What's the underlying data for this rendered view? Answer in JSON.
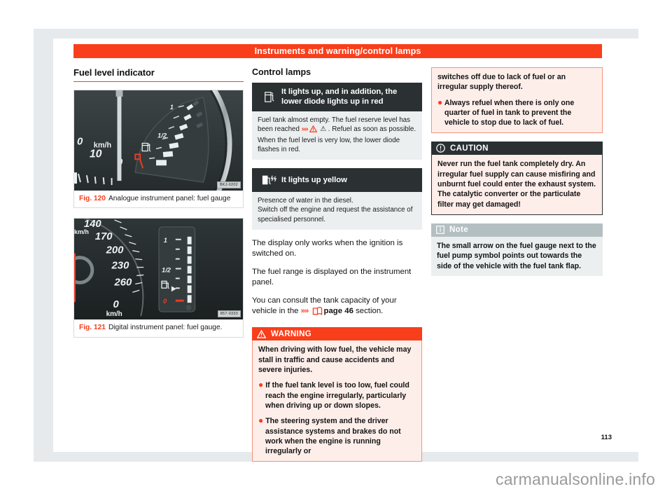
{
  "chapter": {
    "title": "Instruments and warning/control lamps"
  },
  "left_column": {
    "heading": "Fuel level indicator",
    "figures": [
      {
        "number": "Fig. 120",
        "caption": "Analogue instrument panel: fuel gauge",
        "stamp": "BKJ-0202",
        "alt": "analogue-instrument-panel-fuel-gauge",
        "labels": {
          "unit": "km/h",
          "full": "1",
          "half": "1/2",
          "speed_a": "0",
          "speed_b": "10",
          "speed_c": "0"
        }
      },
      {
        "number": "Fig. 121",
        "caption": "Digital instrument panel: fuel gauge.",
        "stamp": "857-0333",
        "alt": "digital-instrument-panel-fuel-gauge",
        "labels": {
          "unit": "km/h",
          "full": "1",
          "half": "1/2",
          "empty": "0",
          "zero": "0",
          "s1": "140",
          "s2": "170",
          "s3": "200",
          "s4": "230",
          "s5": "260"
        }
      }
    ]
  },
  "mid_column": {
    "heading": "Control lamps",
    "lamps": [
      {
        "icon": "fuel-pump-icon",
        "title": "It lights up, and in addition, the lower diode lights up in red",
        "body_parts": [
          "Fuel tank almost empty. The fuel reserve level has been reached ",
          "»»",
          " ⚠ . Refuel as soon as possible. When the fuel level is very low, the lower diode flashes in red."
        ]
      },
      {
        "icon": "fuel-water-icon",
        "title": "It lights up yellow",
        "body_parts": [
          "Presence of water in the diesel.",
          "Switch off the engine and request the assistance of specialised personnel."
        ]
      }
    ],
    "paragraphs": [
      "The display only works when the ignition is switched on.",
      "The fuel range is displayed on the instrument panel."
    ],
    "reference_paragraph": {
      "prefix": "You can consult the tank capacity of your vehicle in the ",
      "arrows": "»»",
      "icon": "page-reference-icon",
      "link": "page 46",
      "suffix": " section."
    },
    "warning": {
      "label": "WARNING",
      "icon": "warning-triangle-icon",
      "paragraphs": [
        "When driving with low fuel, the vehicle may stall in traffic and cause accidents and severe injuries.",
        "If the fuel tank level is too low, fuel could reach the engine irregularly, particularly when driving up or down slopes.",
        "The steering system and the driver assistance systems and brakes do not work when the engine is running irregularly or"
      ],
      "bullets": [
        false,
        true,
        true
      ]
    }
  },
  "right_column": {
    "warning_continued": {
      "paragraphs": [
        "switches off due to lack of fuel or an irregular supply thereof.",
        "Always refuel when there is only one quarter of fuel in tank to prevent the vehicle to stop due to lack of fuel."
      ],
      "bullets": [
        false,
        true
      ]
    },
    "caution": {
      "label": "CAUTION",
      "icon": "caution-circle-icon",
      "body": "Never run the fuel tank completely dry. An irregular fuel supply can cause misfiring and unburnt fuel could enter the exhaust system. The catalytic converter or the particulate filter may get damaged!"
    },
    "note": {
      "label": "Note",
      "icon": "note-info-icon",
      "body": "The small arrow on the fuel gauge next to the fuel pump symbol points out towards the side of the vehicle with the fuel tank flap."
    }
  },
  "page_number": "113",
  "footer": {
    "watermark": "carmanualsonline.info"
  },
  "colors": {
    "accent_red": "#f93e1b",
    "dark_bar": "#2b3133",
    "note_bar": "#b4bfc2",
    "tint_bg": "#fdeeea",
    "grey_bg": "#eceff0",
    "page_backdrop": "#e6eaec"
  }
}
